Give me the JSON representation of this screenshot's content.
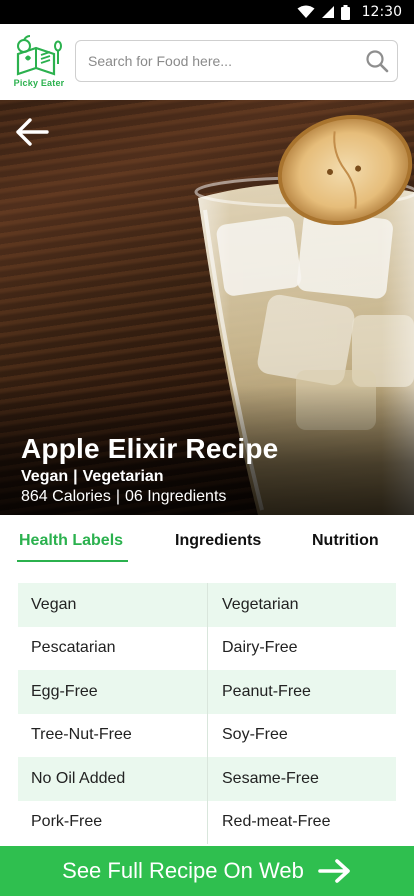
{
  "status_bar": {
    "time": "12:30",
    "icons": [
      "wifi-icon",
      "signal-icon",
      "battery-icon"
    ]
  },
  "header": {
    "logo_text": "Picky Eater",
    "search": {
      "placeholder": "Search for Food here...",
      "value": ""
    }
  },
  "hero": {
    "title": "Apple Elixir Recipe",
    "tags": [
      "Vegan",
      "Vegetarian"
    ],
    "calories": "864 Calories",
    "ingredients_count": "06 Ingredients"
  },
  "tabs": [
    {
      "label": "Health Labels",
      "active": true
    },
    {
      "label": "Ingredients",
      "active": false
    },
    {
      "label": "Nutrition",
      "active": false
    }
  ],
  "health_labels": [
    [
      "Vegan",
      "Vegetarian"
    ],
    [
      "Pescatarian",
      "Dairy-Free"
    ],
    [
      "Egg-Free",
      "Peanut-Free"
    ],
    [
      "Tree-Nut-Free",
      "Soy-Free"
    ],
    [
      "No Oil Added",
      "Sesame-Free"
    ],
    [
      "Pork-Free",
      "Red-meat-Free"
    ]
  ],
  "cta": {
    "label": "See Full Recipe On Web"
  },
  "colors": {
    "accent": "#2bb14e",
    "cta": "#2fbf4f",
    "row_alt": "#eaf8ee"
  }
}
